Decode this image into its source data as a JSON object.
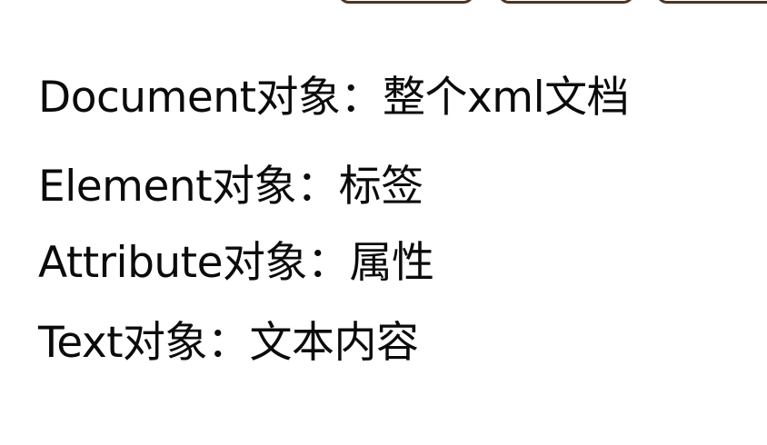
{
  "lines": [
    "Document对象：整个xml文档",
    "Element对象：标签",
    "Attribute对象：属性",
    "Text对象：文本内容"
  ]
}
